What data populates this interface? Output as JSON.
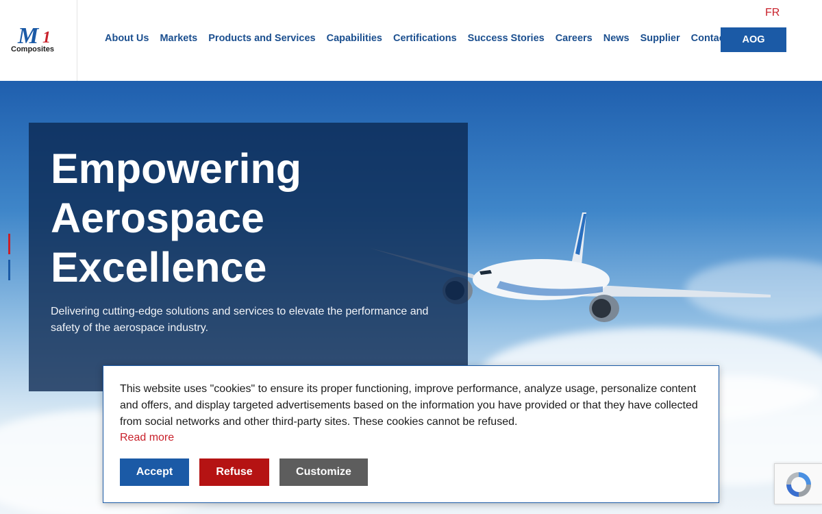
{
  "header": {
    "logo_mark": "M",
    "logo_digit": "1",
    "logo_text": "Composites",
    "lang_toggle": "FR",
    "nav": [
      {
        "label": "About Us"
      },
      {
        "label": "Markets"
      },
      {
        "label": "Products and Services"
      },
      {
        "label": "Capabilities"
      },
      {
        "label": "Certifications"
      },
      {
        "label": "Success Stories"
      },
      {
        "label": "Careers"
      },
      {
        "label": "News"
      },
      {
        "label": "Supplier"
      },
      {
        "label": "Contact"
      }
    ],
    "aog_label": "AOG"
  },
  "hero": {
    "title": "Empowering Aerospace Excellence",
    "subtitle": "Delivering cutting-edge solutions and services to elevate the performance and safety of the aerospace industry."
  },
  "cookie": {
    "text": "This website uses \"cookies\" to ensure its proper functioning, improve performance, analyze usage, personalize content and offers, and display targeted advertisements based on the information you have provided or that they have collected from social networks and other third-party sites. These cookies cannot be refused.",
    "read_more": "Read more",
    "accept": "Accept",
    "refuse": "Refuse",
    "customize": "Customize"
  },
  "colors": {
    "brand_blue": "#1b5aa6",
    "brand_red": "#c8202a",
    "nav_text": "#1b4f8f",
    "refuse_red": "#b51313",
    "customize_gray": "#5d5d5d"
  },
  "icons": {
    "recaptcha": "recaptcha-icon",
    "plane": "airplane-image"
  }
}
